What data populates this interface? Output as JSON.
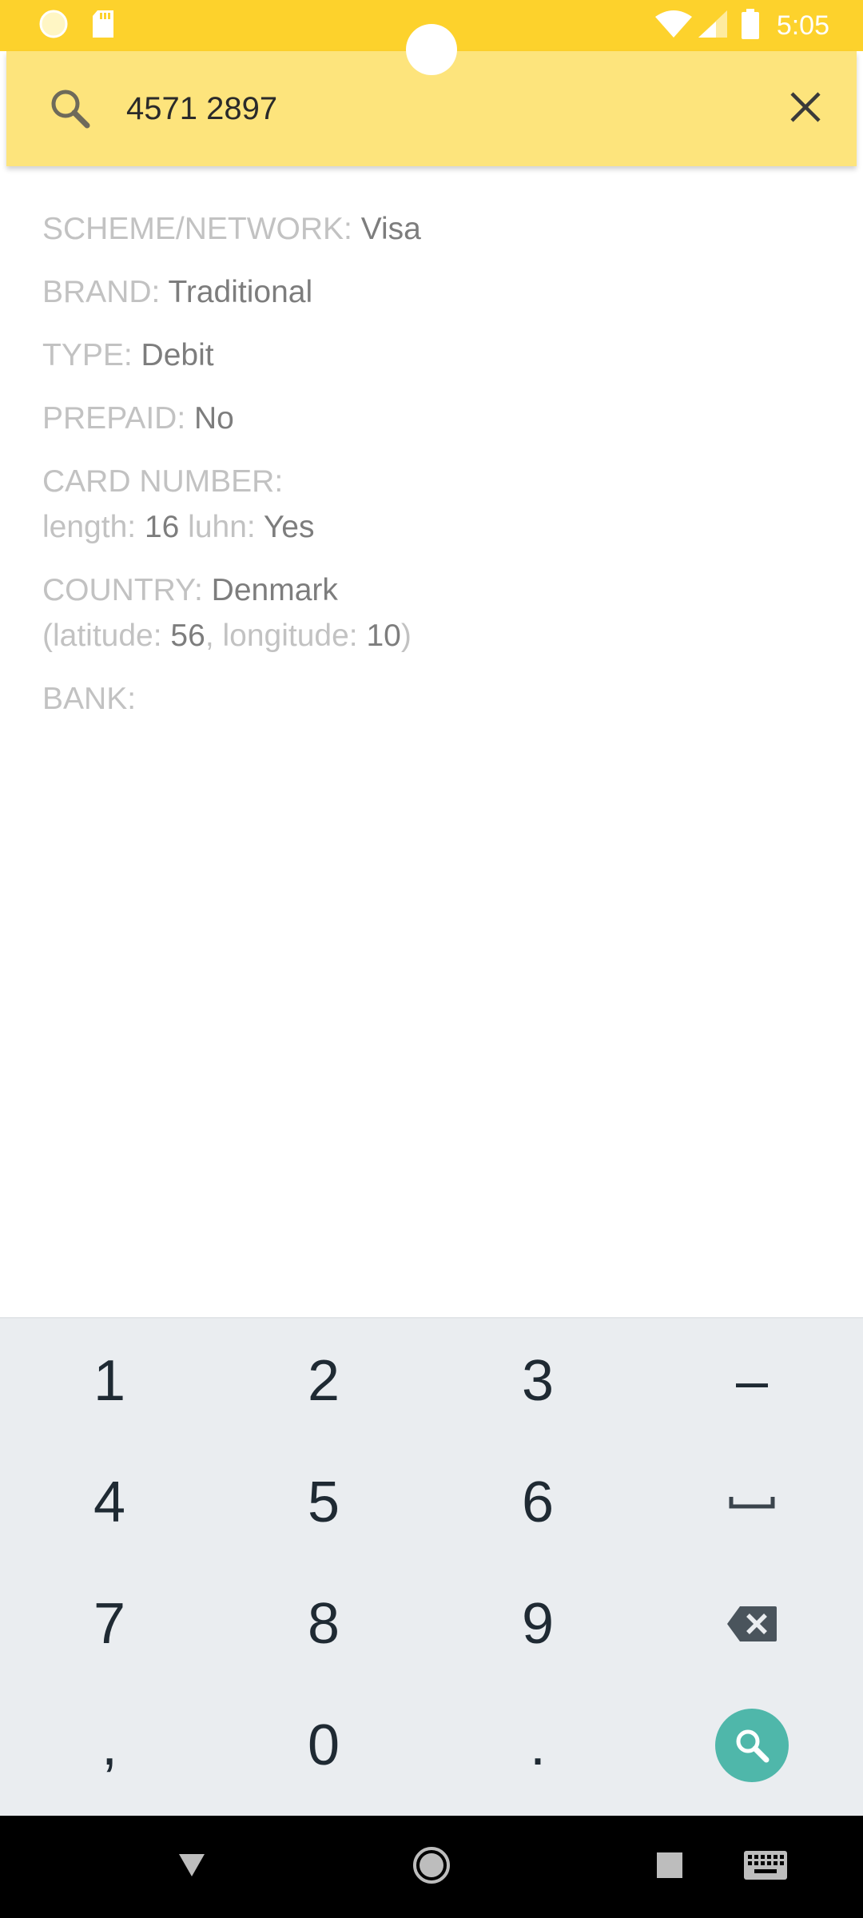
{
  "status_bar": {
    "time": "5:05"
  },
  "search": {
    "query": "4571 2897"
  },
  "info": {
    "scheme_label": "SCHEME/NETWORK: ",
    "scheme_value": "Visa",
    "brand_label": "BRAND: ",
    "brand_value": "Traditional",
    "type_label": "TYPE: ",
    "type_value": "Debit",
    "prepaid_label": "PREPAID: ",
    "prepaid_value": "No",
    "card_number_label": "CARD NUMBER:",
    "length_label": "length: ",
    "length_value": "16",
    "luhn_label": " luhn: ",
    "luhn_value": "Yes",
    "country_label": "COUNTRY: ",
    "country_value": "Denmark",
    "lat_label": "(latitude: ",
    "lat_value": "56",
    "lon_label": ", longitude: ",
    "lon_value": "10",
    "close_paren": ")",
    "bank_label": "BANK:"
  },
  "keypad": {
    "keys": [
      "1",
      "2",
      "3",
      "–",
      "4",
      "5",
      "6",
      "7",
      "8",
      "9",
      ",",
      "0",
      "."
    ]
  },
  "colors": {
    "status_bar": "#fdd22c",
    "search_bar": "#fde47c",
    "label": "#c2c2c2",
    "value": "#7d7d7d",
    "keypad_bg": "#eaedf0",
    "search_key": "#4fb7aa"
  },
  "icons": {
    "status_left": [
      "circle-notification-icon",
      "sd-card-icon"
    ],
    "status_right": [
      "wifi-icon",
      "cell-signal-icon",
      "battery-icon"
    ],
    "search": "search-icon",
    "clear": "close-icon",
    "keypad_special": [
      "space-key-icon",
      "backspace-icon",
      "search-key-icon"
    ],
    "nav": [
      "back-icon",
      "home-icon",
      "recents-icon",
      "keyboard-icon"
    ]
  }
}
